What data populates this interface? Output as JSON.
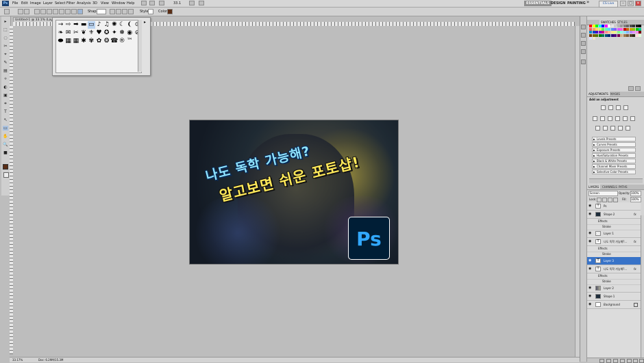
{
  "app": {
    "logo": "Ps"
  },
  "menu": [
    "File",
    "Edit",
    "Image",
    "Layer",
    "Select",
    "Filter",
    "Analysis",
    "3D",
    "View",
    "Window",
    "Help"
  ],
  "menubar": {
    "zoom": "33.1",
    "workspaces": [
      "ESSENTIALS",
      "DESIGN",
      "PAINTING"
    ],
    "more": "»",
    "cs_live": "CS Live",
    "window_controls": [
      "–",
      "□",
      "✕"
    ]
  },
  "options_bar": {
    "shape_label": "Shapes:",
    "style_label": "Style:",
    "color_label": "Color:",
    "color_value": "#5a2e16"
  },
  "document": {
    "tab_title": "Untitled-1 @ 33.1% (Layer 3, RGB/8)",
    "status_zoom": "33.17%",
    "status_doc": "Doc: 6.29M/15.3M"
  },
  "tools": [
    "▸",
    "⬚",
    "◌",
    "✂",
    "⌖",
    "✎",
    "▤",
    "✧",
    "◐",
    "▣",
    "⌗",
    "T",
    "↖",
    "▭",
    "✋",
    "🔍",
    "■"
  ],
  "shape_picker": {
    "shapes": [
      "→",
      "⇨",
      "➡",
      "▬",
      "▭",
      "♪",
      "♫",
      "✺",
      "☾",
      "❨",
      "⊙",
      "❧",
      "✉",
      "✂",
      "❦",
      "⚜",
      "♥",
      "✪",
      "✦",
      "❅",
      "◉",
      "⊘",
      "⬬",
      "▦",
      "▦",
      "✱",
      "✾",
      "✿",
      "❂",
      "☎",
      "®",
      "™"
    ],
    "menu_arrow": "▸"
  },
  "canvas": {
    "line1": "나도 독학 가능해?",
    "line2": "알고보면 쉬운 포토샵!",
    "logo": "Ps"
  },
  "swatches_panel": {
    "tabs": [
      "SWATCHES",
      "STYLES"
    ],
    "colors": [
      "#ff0000",
      "#ffff00",
      "#00ff00",
      "#00ffff",
      "#0000ff",
      "#ff00ff",
      "#ffffff",
      "#e6e6e6",
      "#cccccc",
      "#b3b3b3",
      "#999999",
      "#808080",
      "#666666",
      "#4d4d4d",
      "#333333",
      "#1a1a1a",
      "#000000",
      "#ff5a5a",
      "#ffa05a",
      "#ffd75a",
      "#d7ff5a",
      "#5aff5a",
      "#5affc8",
      "#5ad7ff",
      "#5a8cff",
      "#8c5aff",
      "#d75aff",
      "#ff5ad7",
      "#c80000",
      "#c86400",
      "#c8a000",
      "#8cc800",
      "#00c800",
      "#00c88c",
      "#008cc8",
      "#0046c8",
      "#4600c8",
      "#8c00c8",
      "#c8008c",
      "#ff8c8c",
      "#ffc38c",
      "#ffe68c",
      "#e6ff8c",
      "#8cff8c",
      "#8cffe6",
      "#8ce6ff",
      "#8cb4ff",
      "#b48cff",
      "#e68cff",
      "#ff8ce6",
      "#780000",
      "#783c00",
      "#786400",
      "#507800",
      "#007800",
      "#007850",
      "#005078",
      "#002878",
      "#280078",
      "#500078",
      "#780050",
      "#d2b48c",
      "#a0784b",
      "#785a37",
      "#503c23",
      "#2d2314",
      "#ffdcdc",
      "#dcffdc",
      "#dcdcff",
      "#f0e6d2"
    ]
  },
  "adjustments_panel": {
    "tabs": [
      "ADJUSTMENTS",
      "MASKS"
    ],
    "title": "Add an adjustment",
    "presets": [
      "Levels Presets",
      "Curves Presets",
      "Exposure Presets",
      "Hue/Saturation Presets",
      "Black & White Presets",
      "Channel Mixer Presets",
      "Selective Color Presets"
    ]
  },
  "layers_panel": {
    "tabs": [
      "LAYERS",
      "CHANNELS",
      "PATHS"
    ],
    "blend_mode": "Screen",
    "opacity_label": "Opacity:",
    "opacity": "100%",
    "lock_label": "Lock:",
    "fill_label": "Fill:",
    "fill": "100%",
    "rows": [
      {
        "type": "layer",
        "name": "Ps",
        "kind": "text"
      },
      {
        "type": "layer",
        "name": "Shape 2",
        "kind": "shape",
        "fx": "fx"
      },
      {
        "type": "sub",
        "name": "Effects"
      },
      {
        "type": "sub",
        "name": "Stroke"
      },
      {
        "type": "layer",
        "name": "Layer 1",
        "kind": "empty"
      },
      {
        "type": "layer",
        "name": "나도 독학 가능해?...",
        "kind": "text",
        "fx": "fx"
      },
      {
        "type": "sub",
        "name": "Effects"
      },
      {
        "type": "sub",
        "name": "Stroke"
      },
      {
        "type": "layer",
        "name": "Layer 3",
        "kind": "text",
        "selected": true
      },
      {
        "type": "layer",
        "name": "나도 독학 가능해?...",
        "kind": "text",
        "fx": "fx"
      },
      {
        "type": "sub",
        "name": "Effects"
      },
      {
        "type": "sub",
        "name": "Stroke"
      },
      {
        "type": "layer",
        "name": "Layer 2",
        "kind": "image"
      },
      {
        "type": "layer",
        "name": "Shape 1",
        "kind": "shape"
      },
      {
        "type": "layer",
        "name": "Background",
        "kind": "bg",
        "locked": true
      }
    ]
  }
}
